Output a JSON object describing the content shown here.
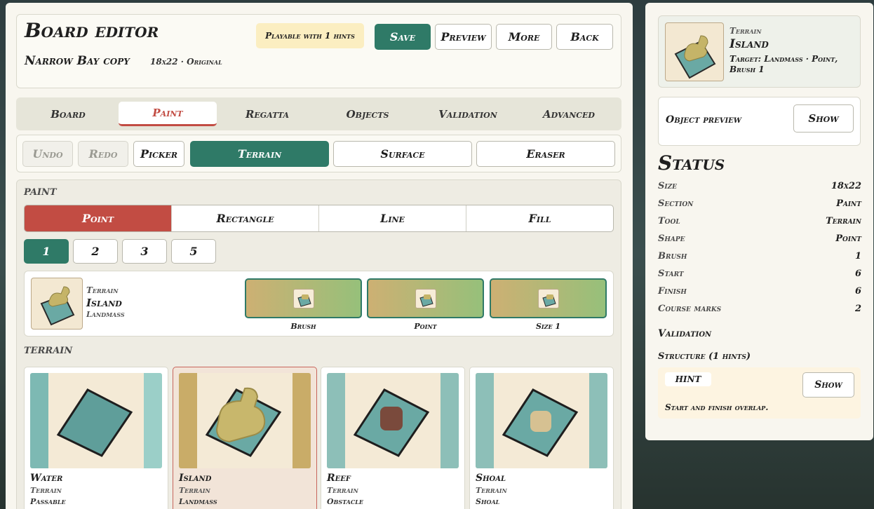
{
  "header": {
    "title": "Board editor",
    "board_name": "Narrow Bay copy",
    "board_meta": "18x22 · Original",
    "hint_badge": "Playable with 1 hints",
    "buttons": {
      "save": "Save",
      "preview": "Preview",
      "more": "More",
      "back": "Back"
    }
  },
  "tabs": [
    "Board",
    "Paint",
    "Regatta",
    "Objects",
    "Validation",
    "Advanced"
  ],
  "active_tab": "Paint",
  "toolbar": {
    "undo": "Undo",
    "redo": "Redo",
    "picker": "Picker",
    "terrain": "Terrain",
    "surface": "Surface",
    "eraser": "Eraser"
  },
  "paint": {
    "section_label": "PAINT",
    "shapes": [
      "Point",
      "Rectangle",
      "Line",
      "Fill"
    ],
    "active_shape": "Point",
    "sizes": [
      "1",
      "2",
      "3",
      "5"
    ],
    "active_size": "1",
    "selected": {
      "kind": "Terrain",
      "name": "Island",
      "category": "Landmass"
    },
    "previews": [
      "Brush",
      "Point",
      "Size 1"
    ]
  },
  "terrain": {
    "section_label": "TERRAIN",
    "tiles": [
      {
        "name": "Water",
        "kind": "Terrain",
        "tag": "Passable"
      },
      {
        "name": "Island",
        "kind": "Terrain",
        "tag": "Landmass"
      },
      {
        "name": "Reef",
        "kind": "Terrain",
        "tag": "Obstacle"
      },
      {
        "name": "Shoal",
        "kind": "Terrain",
        "tag": "Shoal"
      }
    ]
  },
  "sidebar": {
    "object": {
      "kind": "Terrain",
      "name": "Island",
      "target": "Target: Landmass · Point, Brush 1"
    },
    "object_preview_label": "Object preview",
    "show_label": "Show",
    "status_title": "Status",
    "status": [
      {
        "k": "Size",
        "v": "18x22"
      },
      {
        "k": "Section",
        "v": "Paint"
      },
      {
        "k": "Tool",
        "v": "Terrain"
      },
      {
        "k": "Shape",
        "v": "Point"
      },
      {
        "k": "Brush",
        "v": "1"
      },
      {
        "k": "Start",
        "v": "6"
      },
      {
        "k": "Finish",
        "v": "6"
      },
      {
        "k": "Course marks",
        "v": "2"
      }
    ],
    "validation_label": "Validation",
    "structure_label": "Structure (1 hints)",
    "hint_tag": "HINT",
    "hint_show": "Show",
    "hint_text": "Start and finish overlap."
  },
  "colors": {
    "accent_green": "#2f7a67",
    "accent_red": "#c24c43",
    "hint_bg": "#fbeec1"
  }
}
